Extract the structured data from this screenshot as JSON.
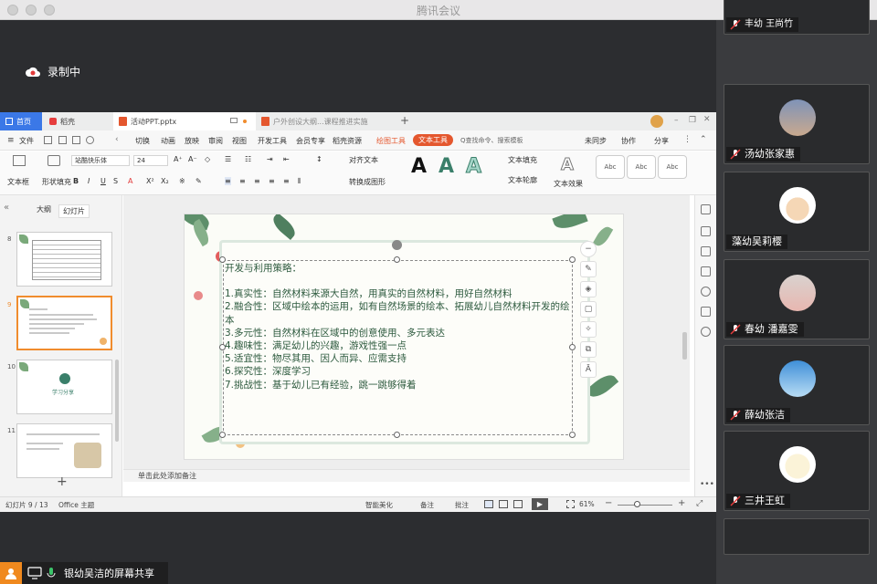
{
  "window": {
    "title": "腾讯会议"
  },
  "recording": {
    "label": "录制中"
  },
  "wps": {
    "tabs": [
      {
        "label": "首页"
      },
      {
        "label": "稻壳"
      },
      {
        "label": "活动PPT.pptx"
      },
      {
        "label": "户外创设大纲...课程推进实施"
      }
    ],
    "menu": {
      "file": "文件",
      "items": [
        "切换",
        "动画",
        "放映",
        "审阅",
        "视图",
        "开发工具",
        "会员专享",
        "稻壳资源",
        "绘图工具",
        "文本工具"
      ],
      "search": "Q查找命令、搜索模板",
      "right_items": [
        "未同步",
        "协作",
        "分享"
      ]
    },
    "ribbon": {
      "textbox": "文本框",
      "shape_fill": "形状填充",
      "font_name": "站酷快乐体",
      "font_size": "24",
      "align": "对齐文本",
      "convert": "转换成图形",
      "text_fill": "文本填充",
      "text_outline": "文本轮廓",
      "text_effect": "文本效果",
      "style_label": "Abc"
    },
    "thumb_panel": {
      "tab_outline": "大纲",
      "tab_slides": "幻灯片",
      "slides": [
        {
          "num": "8"
        },
        {
          "num": "9"
        },
        {
          "num": "10",
          "caption": "学习分享"
        },
        {
          "num": "11"
        }
      ]
    },
    "slide": {
      "lines": [
        "开发与利用策略：",
        "",
        "1.真实性：自然材料来源大自然，用真实的自然材料，用好自然材料",
        "2.融合性：区域中绘本的运用，如有自然场景的绘本、拓展幼儿自然材料开发的绘本",
        "3.多元性：自然材料在区域中的创意使用、多元表达",
        "4.趣味性：满足幼儿的兴趣，游戏性强一点",
        "5.适宜性：物尽其用、因人而异、应需支持",
        "6.探究性：深度学习",
        "7.挑战性：基于幼儿已有经验，跳一跳够得着"
      ]
    },
    "notes_placeholder": "单击此处添加备注",
    "status": {
      "slide_count": "幻灯片 9 / 13",
      "theme": "Office 主题",
      "beautify": "智能美化",
      "notes": "备注",
      "comment": "批注",
      "zoom": "61%"
    }
  },
  "participants": [
    {
      "name": "汤幼张家惠",
      "avatar": "photo"
    },
    {
      "name": "藻幼吴莉樱",
      "avatar": "cartoon"
    },
    {
      "name": "春幼 潘嘉雯",
      "avatar": "photo"
    },
    {
      "name": "薛幼张洁",
      "avatar": "sky"
    },
    {
      "name": "三井王虹",
      "avatar": "cartoon"
    }
  ],
  "participant_partial": "丰幼 王尚竹",
  "share": {
    "label": "银幼吴洁的屏幕共享"
  },
  "colors": {
    "accent": "#3b78e7",
    "slide_text": "#2d5a3e",
    "share_avatar": "#f0891e"
  }
}
